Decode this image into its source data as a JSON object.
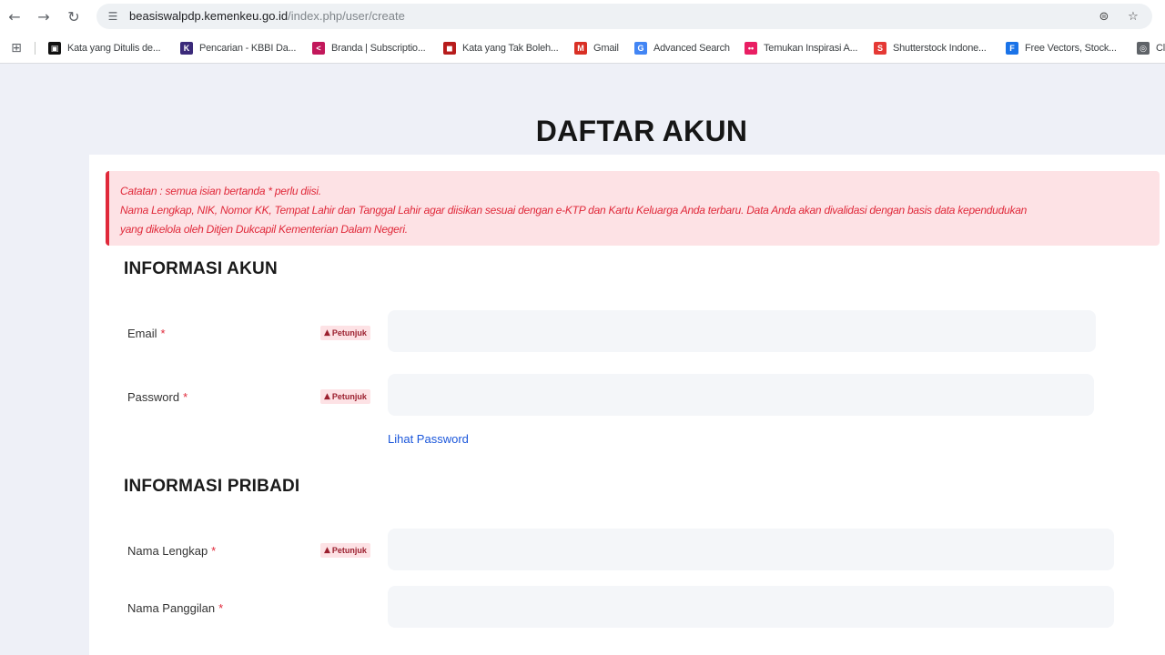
{
  "browser": {
    "url_host": "beasiswalpdp.kemenkeu.go.id",
    "url_path": "/index.php/user/create",
    "back_icon": "←",
    "forward_icon": "→",
    "reload_icon": "↻",
    "site_settings_icon": "☰",
    "translate_icon": "⊜",
    "bookmark_star_icon": "☆",
    "apps_icon": "⊞",
    "bookmarks": [
      {
        "label": "Kata yang Ditulis de...",
        "icon": "▣",
        "color": "#111111"
      },
      {
        "label": "Pencarian - KBBI Da...",
        "icon": "K",
        "color": "#3b2a7a"
      },
      {
        "label": "Branda | Subscriptio...",
        "icon": "<",
        "color": "#c2185b"
      },
      {
        "label": "Kata yang Tak Boleh...",
        "icon": "◼",
        "color": "#b71c1c"
      },
      {
        "label": "Gmail",
        "icon": "M",
        "color": "#d93025"
      },
      {
        "label": "Advanced Search",
        "icon": "G",
        "color": "#4285f4"
      },
      {
        "label": "Temukan Inspirasi A...",
        "icon": "••",
        "color": "#e91e63"
      },
      {
        "label": "Shutterstock Indone...",
        "icon": "S",
        "color": "#e53935"
      },
      {
        "label": "Free Vectors, Stock...",
        "icon": "F",
        "color": "#1a73e8"
      },
      {
        "label": "Cl",
        "icon": "◎",
        "color": "#5f6368"
      }
    ]
  },
  "page": {
    "title": "DAFTAR AKUN",
    "alert": {
      "line1": "Catatan : semua isian bertanda * perlu diisi.",
      "line2": "Nama Lengkap, NIK, Nomor KK, Tempat Lahir dan Tanggal Lahir agar diisikan sesuai dengan e-KTP dan Kartu Keluarga Anda terbaru. Data Anda akan divalidasi dengan basis data kependudukan",
      "line3": "yang dikelola oleh Ditjen Dukcapil Kementerian Dalam Negeri."
    },
    "section_account": "INFORMASI AKUN",
    "section_personal": "INFORMASI PRIBADI",
    "required_mark": "*",
    "hint_label": "Petunjuk",
    "hint_icon": "▲",
    "fields": {
      "email": {
        "label": "Email",
        "value": "",
        "placeholder": ""
      },
      "password": {
        "label": "Password",
        "value": "",
        "placeholder": ""
      },
      "full_name": {
        "label": "Nama Lengkap",
        "value": "",
        "placeholder": ""
      },
      "nickname": {
        "label": "Nama Panggilan",
        "value": "",
        "placeholder": ""
      }
    },
    "show_password_link": "Lihat Password"
  }
}
